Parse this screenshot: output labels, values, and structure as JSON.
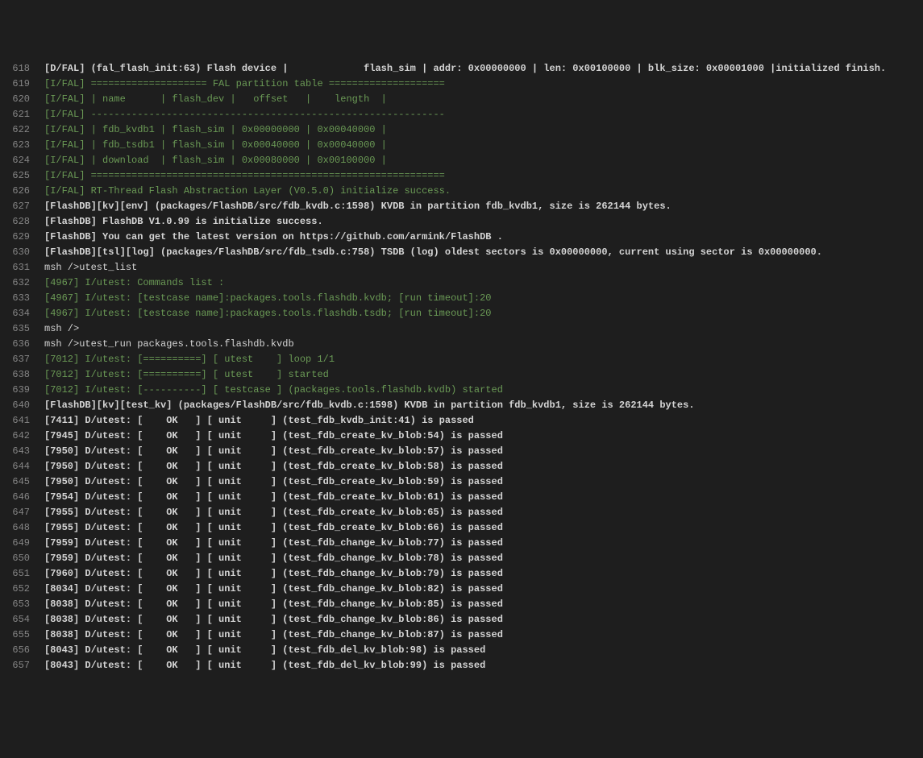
{
  "startLine": 618,
  "lines": [
    {
      "cls": "c-white c-bold",
      "text": "[D/FAL] (fal_flash_init:63) Flash device |             flash_sim | addr: 0x00000000 | len: 0x00100000 | blk_size: 0x00001000 |initialized finish."
    },
    {
      "cls": "c-green",
      "text": "[I/FAL] ==================== FAL partition table ===================="
    },
    {
      "cls": "c-green",
      "text": "[I/FAL] | name      | flash_dev |   offset   |    length  |"
    },
    {
      "cls": "c-green",
      "text": "[I/FAL] -------------------------------------------------------------"
    },
    {
      "cls": "c-green",
      "text": "[I/FAL] | fdb_kvdb1 | flash_sim | 0x00000000 | 0x00040000 |"
    },
    {
      "cls": "c-green",
      "text": "[I/FAL] | fdb_tsdb1 | flash_sim | 0x00040000 | 0x00040000 |"
    },
    {
      "cls": "c-green",
      "text": "[I/FAL] | download  | flash_sim | 0x00080000 | 0x00100000 |"
    },
    {
      "cls": "c-green",
      "text": "[I/FAL] ============================================================="
    },
    {
      "cls": "c-green",
      "text": "[I/FAL] RT-Thread Flash Abstraction Layer (V0.5.0) initialize success."
    },
    {
      "cls": "c-white c-bold",
      "text": "[FlashDB][kv][env] (packages/FlashDB/src/fdb_kvdb.c:1598) KVDB in partition fdb_kvdb1, size is 262144 bytes."
    },
    {
      "cls": "c-white c-bold",
      "text": "[FlashDB] FlashDB V1.0.99 is initialize success."
    },
    {
      "cls": "c-white c-bold",
      "text": "[FlashDB] You can get the latest version on https://github.com/armink/FlashDB ."
    },
    {
      "cls": "c-white c-bold",
      "text": "[FlashDB][tsl][log] (packages/FlashDB/src/fdb_tsdb.c:758) TSDB (log) oldest sectors is 0x00000000, current using sector is 0x00000000."
    },
    {
      "cls": "c-white",
      "text": "msh />utest_list"
    },
    {
      "cls": "c-green",
      "text": "[4967] I/utest: Commands list : "
    },
    {
      "cls": "c-green",
      "text": "[4967] I/utest: [testcase name]:packages.tools.flashdb.kvdb; [run timeout]:20"
    },
    {
      "cls": "c-green",
      "text": "[4967] I/utest: [testcase name]:packages.tools.flashdb.tsdb; [run timeout]:20"
    },
    {
      "cls": "c-white",
      "text": "msh />"
    },
    {
      "cls": "c-white",
      "text": "msh />utest_run packages.tools.flashdb.kvdb"
    },
    {
      "cls": "c-green",
      "text": "[7012] I/utest: [==========] [ utest    ] loop 1/1"
    },
    {
      "cls": "c-green",
      "text": "[7012] I/utest: [==========] [ utest    ] started"
    },
    {
      "cls": "c-green",
      "text": "[7012] I/utest: [----------] [ testcase ] (packages.tools.flashdb.kvdb) started"
    },
    {
      "cls": "c-white c-bold",
      "text": "[FlashDB][kv][test_kv] (packages/FlashDB/src/fdb_kvdb.c:1598) KVDB in partition fdb_kvdb1, size is 262144 bytes."
    },
    {
      "cls": "c-white c-bold",
      "text": "[7411] D/utest: [    OK   ] [ unit     ] (test_fdb_kvdb_init:41) is passed"
    },
    {
      "cls": "c-white c-bold",
      "text": "[7945] D/utest: [    OK   ] [ unit     ] (test_fdb_create_kv_blob:54) is passed"
    },
    {
      "cls": "c-white c-bold",
      "text": "[7950] D/utest: [    OK   ] [ unit     ] (test_fdb_create_kv_blob:57) is passed"
    },
    {
      "cls": "c-white c-bold",
      "text": "[7950] D/utest: [    OK   ] [ unit     ] (test_fdb_create_kv_blob:58) is passed"
    },
    {
      "cls": "c-white c-bold",
      "text": "[7950] D/utest: [    OK   ] [ unit     ] (test_fdb_create_kv_blob:59) is passed"
    },
    {
      "cls": "c-white c-bold",
      "text": "[7954] D/utest: [    OK   ] [ unit     ] (test_fdb_create_kv_blob:61) is passed"
    },
    {
      "cls": "c-white c-bold",
      "text": "[7955] D/utest: [    OK   ] [ unit     ] (test_fdb_create_kv_blob:65) is passed"
    },
    {
      "cls": "c-white c-bold",
      "text": "[7955] D/utest: [    OK   ] [ unit     ] (test_fdb_create_kv_blob:66) is passed"
    },
    {
      "cls": "c-white c-bold",
      "text": "[7959] D/utest: [    OK   ] [ unit     ] (test_fdb_change_kv_blob:77) is passed"
    },
    {
      "cls": "c-white c-bold",
      "text": "[7959] D/utest: [    OK   ] [ unit     ] (test_fdb_change_kv_blob:78) is passed"
    },
    {
      "cls": "c-white c-bold",
      "text": "[7960] D/utest: [    OK   ] [ unit     ] (test_fdb_change_kv_blob:79) is passed"
    },
    {
      "cls": "c-white c-bold",
      "text": "[8034] D/utest: [    OK   ] [ unit     ] (test_fdb_change_kv_blob:82) is passed"
    },
    {
      "cls": "c-white c-bold",
      "text": "[8038] D/utest: [    OK   ] [ unit     ] (test_fdb_change_kv_blob:85) is passed"
    },
    {
      "cls": "c-white c-bold",
      "text": "[8038] D/utest: [    OK   ] [ unit     ] (test_fdb_change_kv_blob:86) is passed"
    },
    {
      "cls": "c-white c-bold",
      "text": "[8038] D/utest: [    OK   ] [ unit     ] (test_fdb_change_kv_blob:87) is passed"
    },
    {
      "cls": "c-white c-bold",
      "text": "[8043] D/utest: [    OK   ] [ unit     ] (test_fdb_del_kv_blob:98) is passed"
    },
    {
      "cls": "c-white c-bold",
      "text": "[8043] D/utest: [    OK   ] [ unit     ] (test_fdb_del_kv_blob:99) is passed"
    }
  ]
}
